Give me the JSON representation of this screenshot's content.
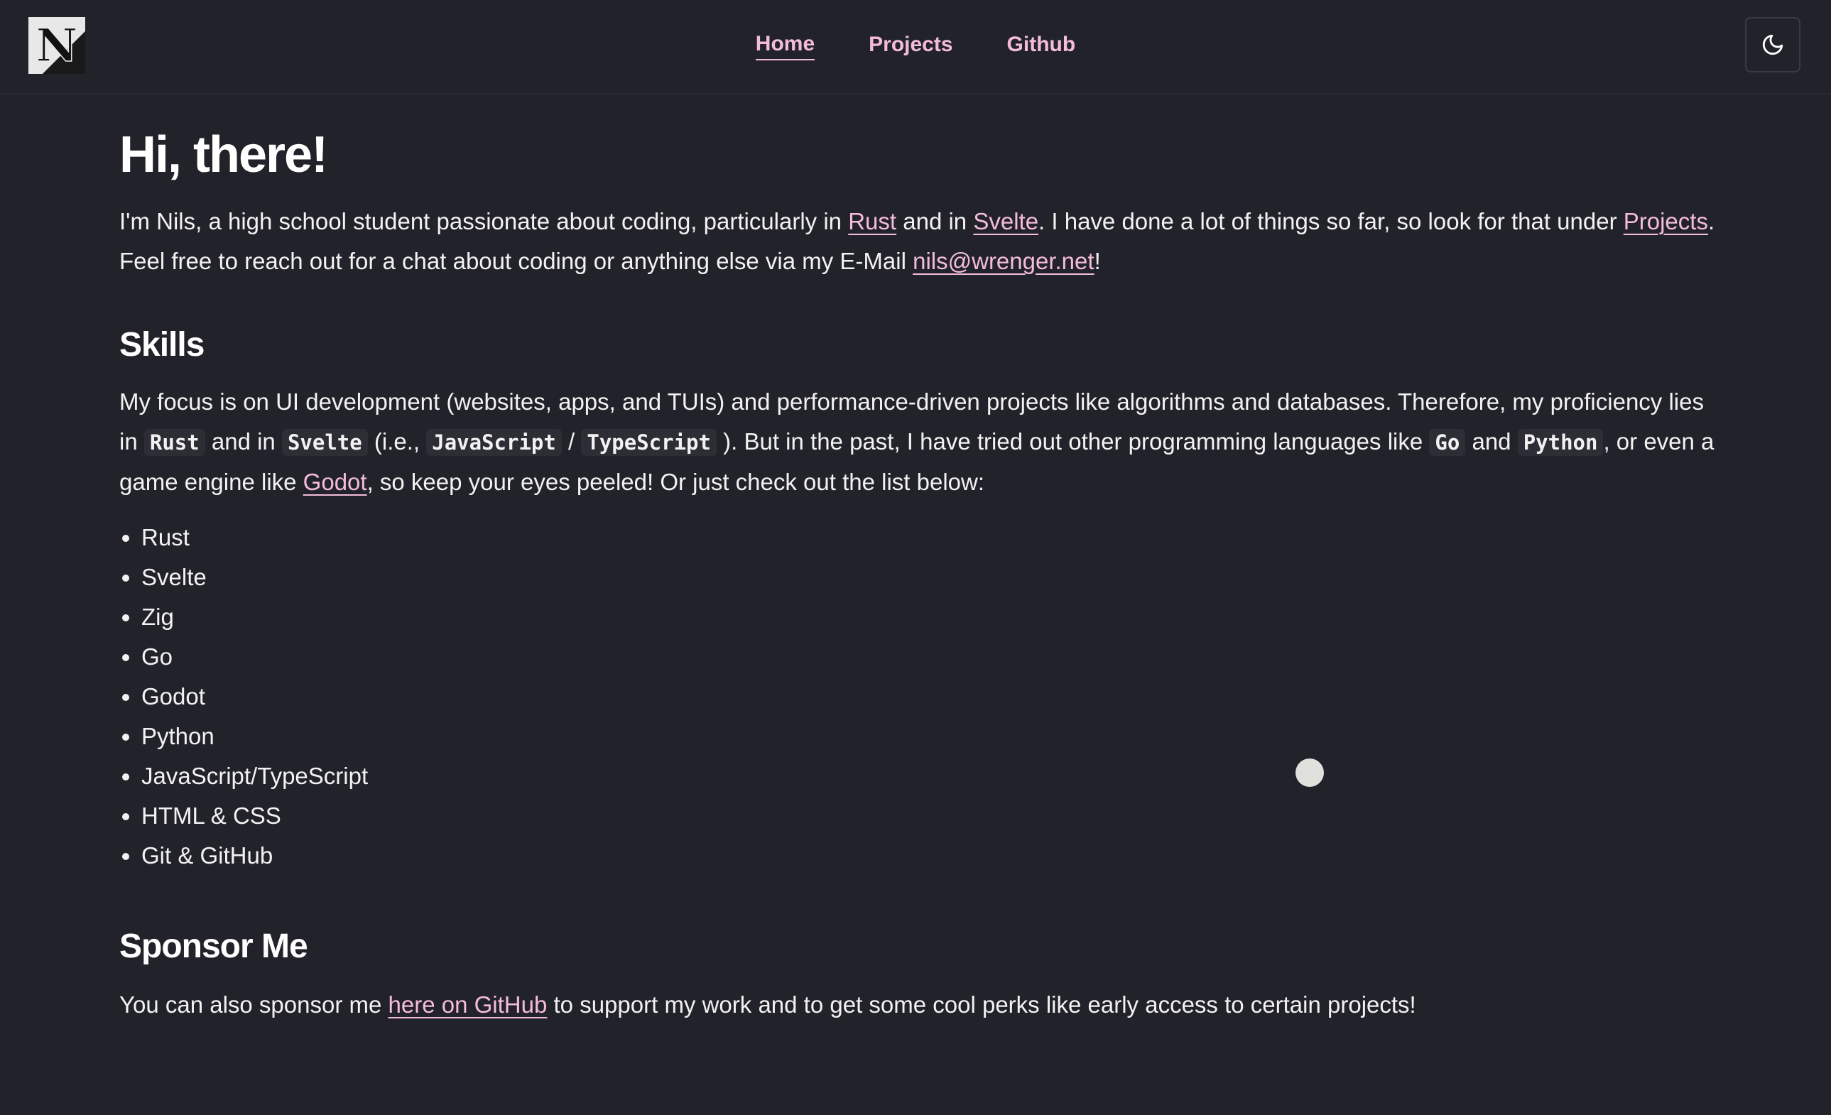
{
  "nav": {
    "links": [
      {
        "label": "Home",
        "active": true
      },
      {
        "label": "Projects",
        "active": false
      },
      {
        "label": "Github",
        "active": false
      }
    ],
    "theme_toggle_icon": "moon-icon",
    "logo_icon": "n-logo-icon"
  },
  "hero": {
    "title": "Hi, there!",
    "intro": {
      "t1": "I'm Nils, a high school student passionate about coding, particularly in ",
      "l1": "Rust",
      "t2": " and in ",
      "l2": "Svelte",
      "t3": ". I have done a lot of things so far, so look for that under ",
      "l3": "Projects",
      "t4": ". Feel free to reach out for a chat about coding or anything else via my E-Mail ",
      "l4": "nils@wrenger.net",
      "t5": "!"
    }
  },
  "skills": {
    "title": "Skills",
    "para": {
      "t1": "My focus is on UI development (websites, apps, and TUIs) and performance-driven projects like algorithms and databases. Therefore, my proficiency lies in ",
      "c1": "Rust",
      "t2": " and in ",
      "c2": "Svelte",
      "t3": " (i.e., ",
      "c3": "JavaScript",
      "t4": " / ",
      "c4": "TypeScript",
      "t5": " ). But in the past, I have tried out other programming languages like ",
      "c5": "Go",
      "t6": " and ",
      "c6": "Python",
      "t7": ", or even a game engine like ",
      "l1": "Godot",
      "t8": ", so keep your eyes peeled! Or just check out the list below:"
    },
    "items": [
      "Rust",
      "Svelte",
      "Zig",
      "Go",
      "Godot",
      "Python",
      "JavaScript/TypeScript",
      "HTML & CSS",
      "Git & GitHub"
    ]
  },
  "sponsor": {
    "title": "Sponsor Me",
    "para": {
      "t1": "You can also sponsor me ",
      "l1": "here on GitHub",
      "t2": " to support my work and to get some cool perks like early access to certain projects!"
    }
  },
  "colors": {
    "background": "#22232a",
    "accent": "#f5bcd9",
    "text": "#ffffff"
  }
}
